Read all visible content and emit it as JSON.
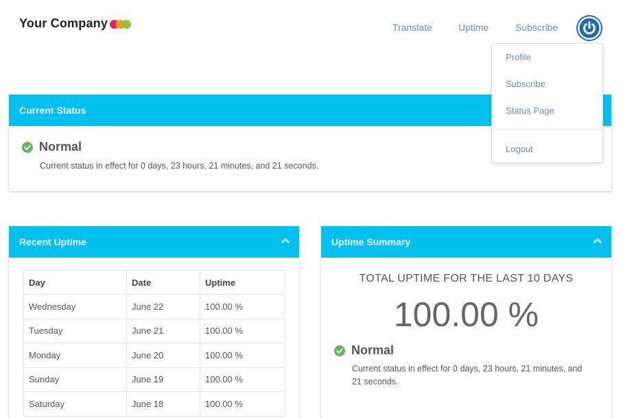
{
  "brand": {
    "name": "Your Company",
    "dot_colors": [
      "#e6205e",
      "#f39c12",
      "#8cc63f"
    ]
  },
  "nav": {
    "translate": "Translate",
    "uptime": "Uptime",
    "subscribe": "Subscribe"
  },
  "user_menu": {
    "icon": "power-icon",
    "items": [
      "Profile",
      "Subscribe",
      "Status Page",
      "Logout"
    ]
  },
  "current_status": {
    "title": "Current Status",
    "status": "Normal",
    "description": "Current status in effect for 0 days, 23 hours, 21 minutes, and 21 seconds."
  },
  "recent_uptime": {
    "title": "Recent Uptime",
    "columns": [
      "Day",
      "Date",
      "Uptime"
    ],
    "rows": [
      [
        "Wednesday",
        "June 22",
        "100.00 %"
      ],
      [
        "Tuesday",
        "June 21",
        "100.00 %"
      ],
      [
        "Monday",
        "June 20",
        "100.00 %"
      ],
      [
        "Sunday",
        "June 19",
        "100.00 %"
      ],
      [
        "Saturday",
        "June 18",
        "100.00 %"
      ]
    ]
  },
  "uptime_summary": {
    "title": "Uptime Summary",
    "heading": "TOTAL UPTIME FOR THE LAST 10 DAYS",
    "value": "100.00 %",
    "status": "Normal",
    "description": "Current status in effect for 0 days, 23 hours, 21 minutes, and 21 seconds."
  },
  "colors": {
    "accent": "#00c0ef",
    "link": "#6a8fb5",
    "success": "#5cb85c",
    "power": "#1a6bb0"
  }
}
